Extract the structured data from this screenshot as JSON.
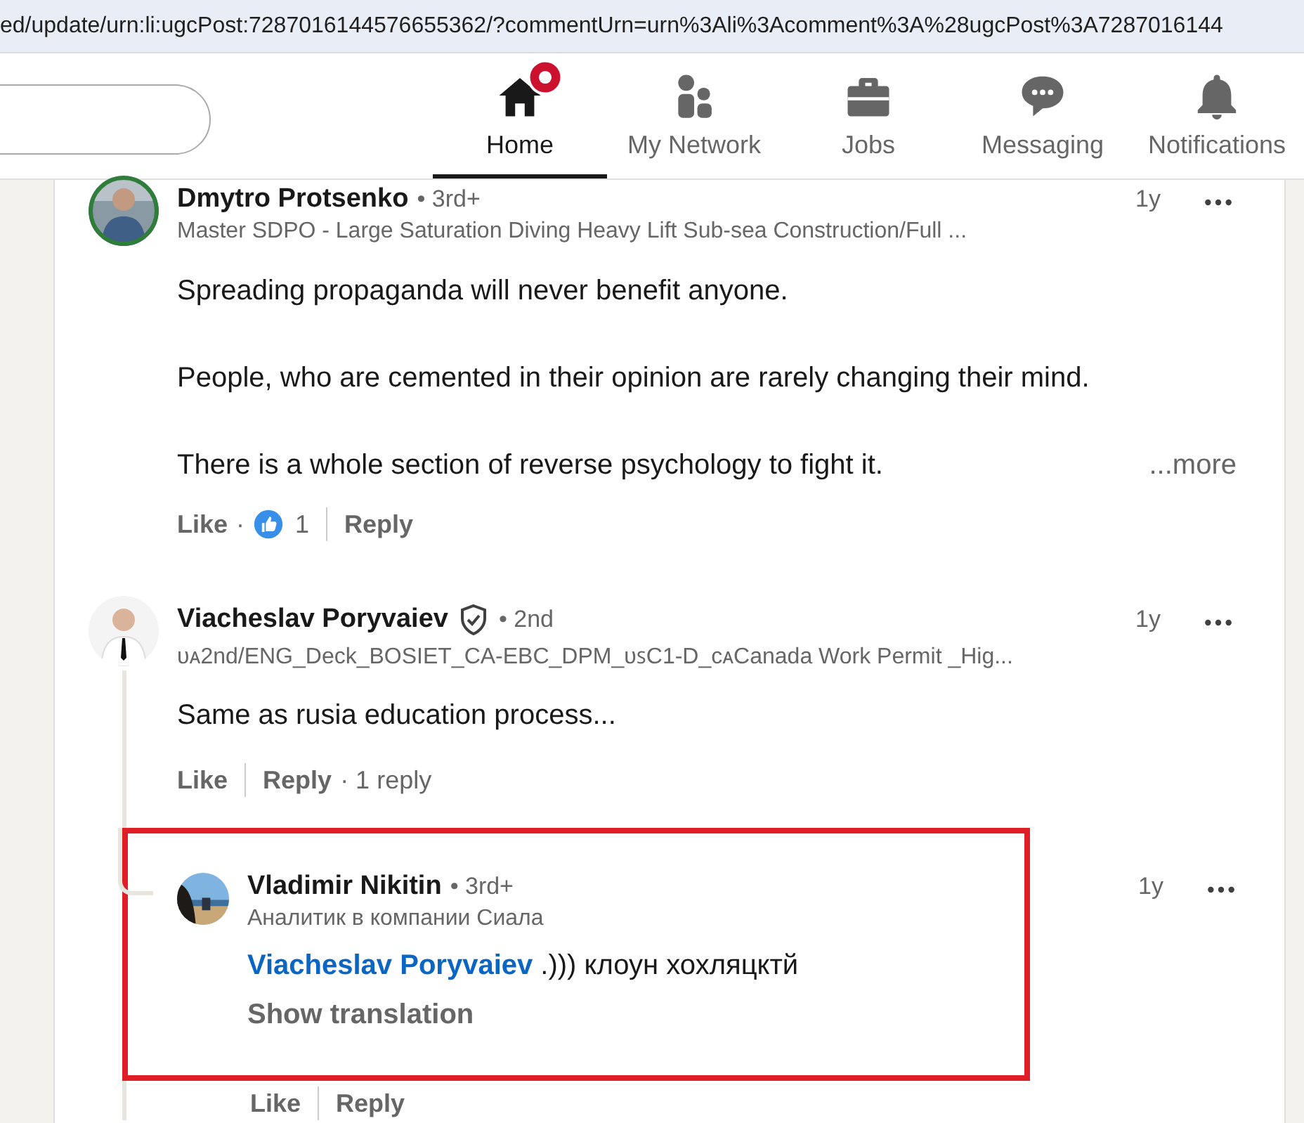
{
  "address_bar": {
    "url": "ed/update/urn:li:ugcPost:7287016144576655362/?commentUrn=urn%3Ali%3Acomment%3A%28ugcPost%3A7287016144"
  },
  "nav": {
    "items": [
      {
        "kind": "home",
        "label": "Home",
        "selected": true,
        "badge": true
      },
      {
        "kind": "network",
        "label": "My Network",
        "selected": false,
        "badge": false
      },
      {
        "kind": "jobs",
        "label": "Jobs",
        "selected": false,
        "badge": false
      },
      {
        "kind": "messaging",
        "label": "Messaging",
        "selected": false,
        "badge": false
      },
      {
        "kind": "notifications",
        "label": "Notifications",
        "selected": false,
        "badge": false
      }
    ]
  },
  "comments": [
    {
      "name": "Dmytro Protsenko",
      "verified": false,
      "degree": "• 3rd+",
      "headline": "Master SDPO - Large Saturation Diving Heavy Lift Sub-sea Construction/Full ...",
      "time": "1y",
      "paragraphs": [
        "Spreading propaganda will never benefit anyone.",
        "People, who are cemented in their opinion are rarely changing their mind.",
        "There is a whole section of reverse psychology to fight it."
      ],
      "more": "...more",
      "like": "Like",
      "reaction_separator": "·",
      "reactions": "1",
      "reply": "Reply"
    },
    {
      "name": "Viacheslav Poryvaiev",
      "verified": true,
      "degree": "• 2nd",
      "headline": "ᴜᴀ2nd/ENG_Deck_BOSIET_CA-EBC_DPM_ᴜꜱC1-D_ᴄᴀCanada Work Permit _Hig...",
      "time": "1y",
      "paragraphs": [
        "Same as rusia education process..."
      ],
      "like": "Like",
      "reply": "Reply",
      "reply_count": "· 1 reply",
      "children": [
        {
          "name": "Vladimir Nikitin",
          "verified": false,
          "degree": "• 3rd+",
          "headline": "Аналитик в компании Сиала",
          "time": "1y",
          "mention": "Viacheslav Poryvaiev",
          "text": ".))) клоун хохляцктй",
          "translation": "Show translation",
          "highlighted": true,
          "like": "Like",
          "reply": "Reply"
        }
      ]
    }
  ]
}
